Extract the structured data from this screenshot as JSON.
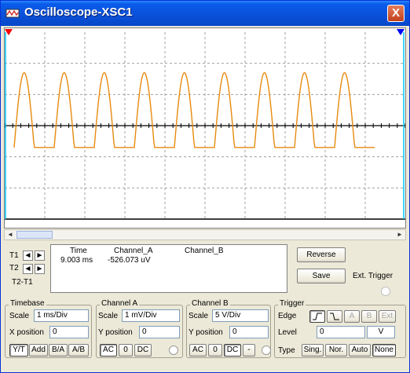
{
  "window": {
    "title": "Oscilloscope-XSC1",
    "close_glyph": "X"
  },
  "colors": {
    "trace_a": "#E88A10",
    "axis": "#000000",
    "grid": "#A0A0A0",
    "cursor_t1": "#FF0000",
    "cursor_t2": "#0000FF",
    "cursor_line": "#00C8FF"
  },
  "chart_data": {
    "type": "line",
    "title": "",
    "xlabel": "",
    "ylabel": "",
    "x_divisions": 10,
    "y_divisions": 6,
    "time_per_div_ms": 1,
    "volts_per_div_mV": 1,
    "series": [
      {
        "waveform": "half-wave rectified sine",
        "periods": 9,
        "period_ms": 1,
        "peak_divisions": 1.7,
        "baseline_divisions": -0.7
      }
    ]
  },
  "cursors": {
    "t1_label": "T1",
    "t2_label": "T2",
    "t2t1_label": "T2-T1",
    "left_glyph": "◄",
    "right_glyph": "►"
  },
  "readout": {
    "headers": [
      "Time",
      "Channel_A",
      "Channel_B"
    ],
    "rows": [
      [
        "9.003 ms",
        "-526.073 uV",
        ""
      ]
    ]
  },
  "buttons": {
    "reverse": "Reverse",
    "save": "Save",
    "ext_trigger": "Ext. Trigger"
  },
  "timebase": {
    "title": "Timebase",
    "scale_label": "Scale",
    "scale_value": "1 ms/Div",
    "xpos_label": "X position",
    "xpos_value": "0",
    "modes": [
      "Y/T",
      "Add",
      "B/A",
      "A/B"
    ]
  },
  "channel_a": {
    "title": "Channel A",
    "scale_label": "Scale",
    "scale_value": "1 mV/Div",
    "ypos_label": "Y position",
    "ypos_value": "0",
    "coupling": [
      "AC",
      "0",
      "DC"
    ]
  },
  "channel_b": {
    "title": "Channel B",
    "scale_label": "Scale",
    "scale_value": "5  V/Div",
    "ypos_label": "Y position",
    "ypos_value": "0",
    "coupling": [
      "AC",
      "0",
      "DC",
      "-"
    ]
  },
  "trigger": {
    "title": "Trigger",
    "edge_label": "Edge",
    "level_label": "Level",
    "level_value": "0",
    "level_unit": "V",
    "sources": [
      "A",
      "B",
      "Ext"
    ],
    "type_label": "Type",
    "types": [
      "Sing.",
      "Nor.",
      "Auto",
      "None"
    ]
  }
}
